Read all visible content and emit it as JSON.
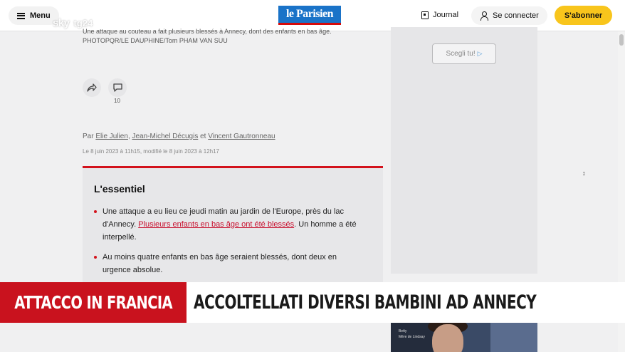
{
  "header": {
    "menu_label": "Menu",
    "brand": "le Parisien",
    "journal_label": "Journal",
    "connect_label": "Se connecter",
    "subscribe_label": "S'abonner"
  },
  "overlay": {
    "channel_sky": "sky",
    "channel_tg": "tg24"
  },
  "article": {
    "caption": "Une attaque au couteau a fait plusieurs blessés à Annecy, dont des enfants en bas âge. PHOTOPQR/LE DAUPHINE/Tom PHAM VAN SUU",
    "comment_count": "10",
    "byline_prefix": "Par",
    "authors": [
      "Elie Julien",
      "Jean-Michel Décugis",
      "Vincent Gautronneau"
    ],
    "byline_sep": ",",
    "byline_and": "et",
    "date": "Le 8 juin 2023 à 11h15, modifié le 8 juin 2023 à 12h17"
  },
  "essentiel": {
    "title": "L'essentiel",
    "bullet1_before": "Une attaque a eu lieu ce jeudi matin au jardin de l'Europe, près du lac d'Annecy.",
    "bullet1_link": "Plusieurs enfants en bas âge ont été blessés",
    "bullet1_after": ". Un homme a été interpellé.",
    "bullet2": "Au moins quatre enfants en bas âge seraient blessés, dont deux en urgence absolue."
  },
  "sidebar": {
    "choose_label": "Scegli tu!",
    "thumb_caption_1": "Betty",
    "thumb_caption_2": "Mère de Lindsay"
  },
  "banner": {
    "kicker": "ATTACCO IN FRANCIA",
    "headline": "ACCOLTELLATI DIVERSI BAMBINI AD ANNECY"
  },
  "colors": {
    "accent_red": "#c9121e",
    "subscribe_yellow": "#f8c51c",
    "brand_blue": "#1a73c8"
  }
}
